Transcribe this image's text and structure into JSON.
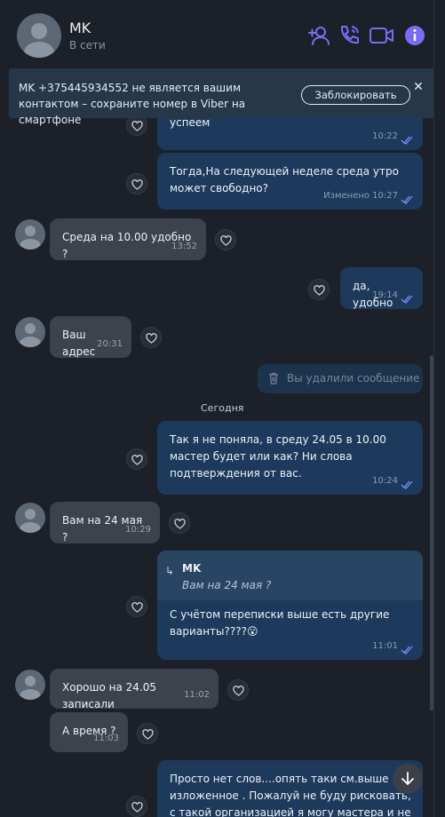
{
  "header": {
    "name": "MK",
    "status": "В сети"
  },
  "banner": {
    "text": "MK +375445934552 не является вашим контактом – сохраните номер в Viber на смартфоне",
    "block_label": "Заблокировать",
    "close_glyph": "✕"
  },
  "messages": [
    {
      "id": "m1",
      "dir": "out",
      "text": "успеем",
      "time": "10:22"
    },
    {
      "id": "m2",
      "dir": "out",
      "text": "Тогда,На следующей неделе среда утро может свободно?",
      "time": "Изменено 10:27"
    },
    {
      "id": "m3",
      "dir": "in",
      "text": "Среда на 10.00 удобно ?",
      "time": "13:52"
    },
    {
      "id": "m4",
      "dir": "out",
      "text": "да, удобно",
      "time": "19:14"
    },
    {
      "id": "m5",
      "dir": "in",
      "text": "Ваш адрес",
      "time": "20:31"
    },
    {
      "id": "m6",
      "dir": "out",
      "text": "Так я не поняла, в среду 24.05 в 10.00 мастер будет или как? Ни слова подтверждения от вас.",
      "time": "10:24"
    },
    {
      "id": "m7",
      "dir": "in",
      "text": "Вам на 24 мая ?",
      "time": "10:29"
    },
    {
      "id": "m8",
      "dir": "out",
      "text": "С учётом переписки выше есть другие варианты????😮",
      "time": "11:01",
      "reply_name": "MK",
      "reply_quote": "Вам на 24 мая ?"
    },
    {
      "id": "m9",
      "dir": "in",
      "text": "Хорошо на 24.05 записали",
      "time": "11:02"
    },
    {
      "id": "m10",
      "dir": "in",
      "text": "А время ?",
      "time": "11:03"
    },
    {
      "id": "m11",
      "dir": "out",
      "text": "Просто нет слов....опять таки см.выше изложенное . Пожалуй не буду рисковать, с такой организацией я могу мастера и не",
      "time": ""
    }
  ],
  "deleted_text": "Вы удалили сообщение",
  "date_separator": "Сегодня",
  "colors": {
    "accent": "#7b6cf6",
    "outgoing": "#1d3a5c",
    "incoming": "#3c434d",
    "background": "#1c2129"
  },
  "icons": [
    "add-contact-icon",
    "phone-icon",
    "video-icon",
    "info-icon",
    "heart-icon",
    "trash-icon",
    "reply-arrow-icon",
    "chevron-down-icon"
  ]
}
